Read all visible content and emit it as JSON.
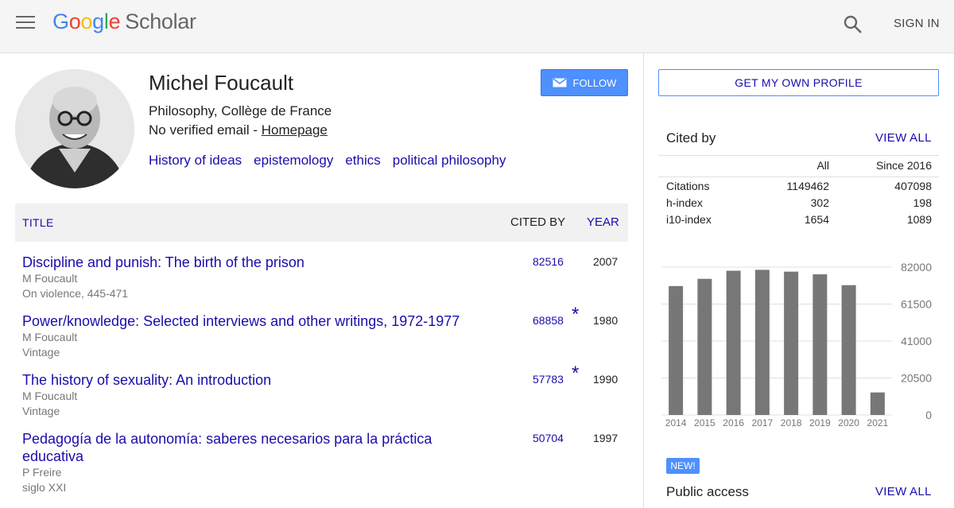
{
  "header": {
    "logo_letters": [
      "G",
      "o",
      "o",
      "g",
      "l",
      "e"
    ],
    "logo_product": "Scholar",
    "sign_in": "SIGN IN",
    "icons": [
      "menu-icon",
      "search-icon"
    ]
  },
  "profile": {
    "name": "Michel Foucault",
    "affiliation": "Philosophy, Collège de France",
    "email_text": "No verified email - ",
    "homepage_label": "Homepage",
    "follow_label": "FOLLOW",
    "interests": [
      "History of ideas",
      "epistemology",
      "ethics",
      "political philosophy"
    ]
  },
  "table": {
    "col_title": "TITLE",
    "col_cited": "CITED BY",
    "col_year": "YEAR",
    "rows": [
      {
        "title": "Discipline and punish: The birth of the prison",
        "authors": "M Foucault",
        "venue": "On violence, 445-471",
        "cited": "82516",
        "star": "",
        "year": "2007"
      },
      {
        "title": "Power/knowledge: Selected interviews and other writings, 1972-1977",
        "authors": "M Foucault",
        "venue": "Vintage",
        "cited": "68858",
        "star": "*",
        "year": "1980"
      },
      {
        "title": "The history of sexuality: An introduction",
        "authors": "M Foucault",
        "venue": "Vintage",
        "cited": "57783",
        "star": "*",
        "year": "1990"
      },
      {
        "title": "Pedagogía de la autonomía: saberes necesarios para la práctica educativa",
        "authors": "P Freire",
        "venue": "siglo XXI",
        "cited": "50704",
        "star": "",
        "year": "1997"
      }
    ]
  },
  "sidebar": {
    "get_profile": "GET MY OWN PROFILE",
    "cited_by": "Cited by",
    "view_all": "VIEW ALL",
    "stats_header": [
      "",
      "All",
      "Since 2016"
    ],
    "stats": [
      {
        "label": "Citations",
        "all": "1149462",
        "since": "407098"
      },
      {
        "label": "h-index",
        "all": "302",
        "since": "198"
      },
      {
        "label": "i10-index",
        "all": "1654",
        "since": "1089"
      }
    ],
    "new_badge": "NEW!",
    "public_access": "Public access",
    "public_view_all": "VIEW ALL"
  },
  "colors": {
    "link": "#1a0dab",
    "accent": "#4d90fe",
    "bar": "#777777"
  },
  "chart_data": {
    "type": "bar",
    "categories": [
      "2014",
      "2015",
      "2016",
      "2017",
      "2018",
      "2019",
      "2020",
      "2021"
    ],
    "values": [
      71500,
      75500,
      80000,
      80500,
      79500,
      78000,
      72000,
      12500
    ],
    "yticks": [
      "82000",
      "61500",
      "41000",
      "20500",
      "0"
    ],
    "ylim": [
      0,
      82000
    ],
    "grid": true
  }
}
